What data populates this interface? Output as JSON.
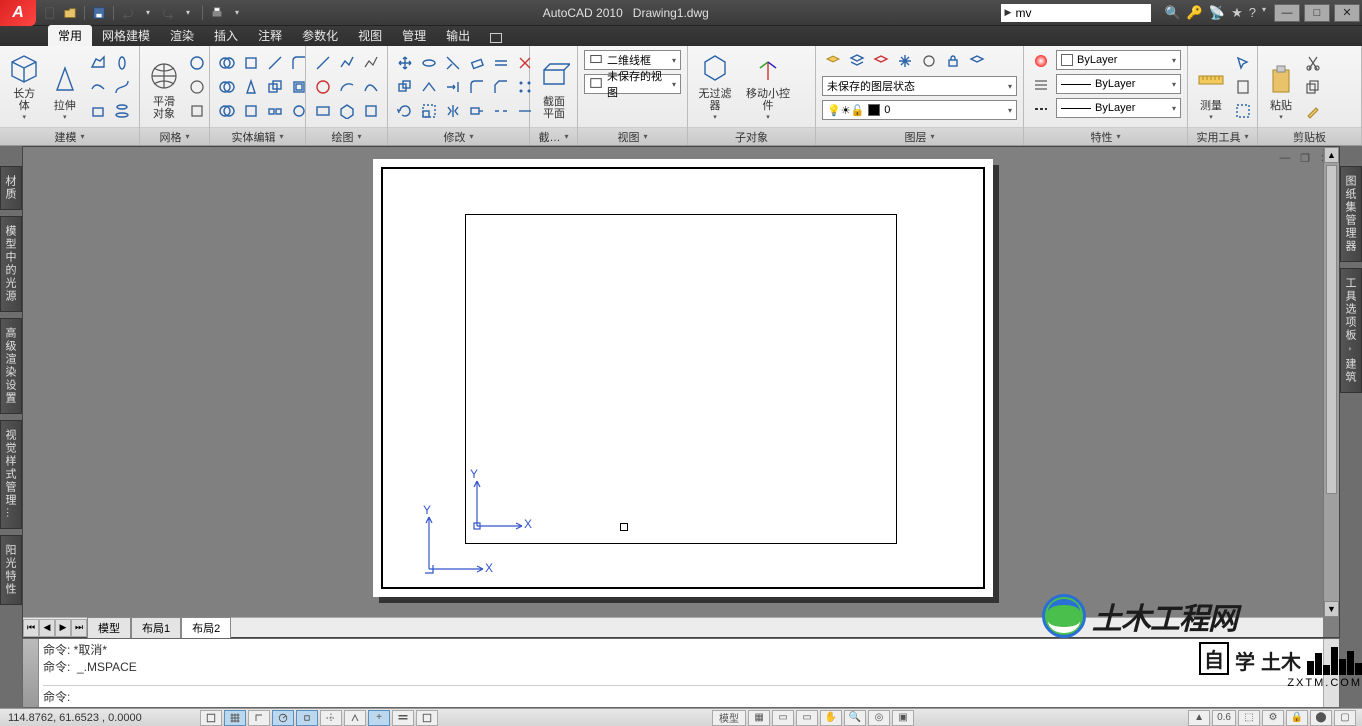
{
  "title": {
    "app": "AutoCAD 2010",
    "doc": "Drawing1.dwg"
  },
  "search": {
    "value": "mv"
  },
  "menus": {
    "items": [
      "常用",
      "网格建模",
      "渲染",
      "插入",
      "注释",
      "参数化",
      "视图",
      "管理",
      "输出"
    ],
    "active": 0
  },
  "ribbon": {
    "modeling": {
      "title": "建模",
      "box": "长方体",
      "extrude": "拉伸"
    },
    "mesh": {
      "title": "网格",
      "smooth": "平滑\n对象"
    },
    "solidedit": {
      "title": "实体编辑"
    },
    "draw": {
      "title": "绘图"
    },
    "modify": {
      "title": "修改"
    },
    "section": {
      "title": "截…",
      "btn": "截面\n平面"
    },
    "view": {
      "title": "视图",
      "style": "二维线框",
      "saved": "未保存的视图"
    },
    "subobj": {
      "title": "子对象",
      "nofilter": "无过滤器",
      "gizmo": "移动小控件"
    },
    "layers": {
      "title": "图层",
      "state": "未保存的图层状态",
      "current": "0"
    },
    "props": {
      "title": "特性",
      "color": "ByLayer",
      "lw": "ByLayer",
      "lt": "ByLayer"
    },
    "utils": {
      "title": "实用工具",
      "measure": "测量"
    },
    "clip": {
      "title": "剪贴板",
      "paste": "粘贴"
    }
  },
  "left_panels": [
    "材质",
    "模型中的光源",
    "高级渲染设置",
    "视觉样式管理…",
    "阳光特性"
  ],
  "right_panels": [
    "图纸集管理器",
    "工具选项板 - 建筑"
  ],
  "sheets": {
    "tabs": [
      "模型",
      "布局1",
      "布局2"
    ],
    "active": 2
  },
  "ucs": {
    "x": "X",
    "y": "Y"
  },
  "command": {
    "hist1": "命令: *取消*",
    "hist2": "命令:  _.MSPACE",
    "prompt": "命令:"
  },
  "status": {
    "coords": "114.8762, 61.6523 , 0.0000",
    "space": "模型",
    "scale_marker": "0.6"
  },
  "watermark": {
    "line1": "土木工程网",
    "zi": "自",
    "xue": "学",
    "tumu": "土木",
    "url": "ZXTM.COM"
  }
}
